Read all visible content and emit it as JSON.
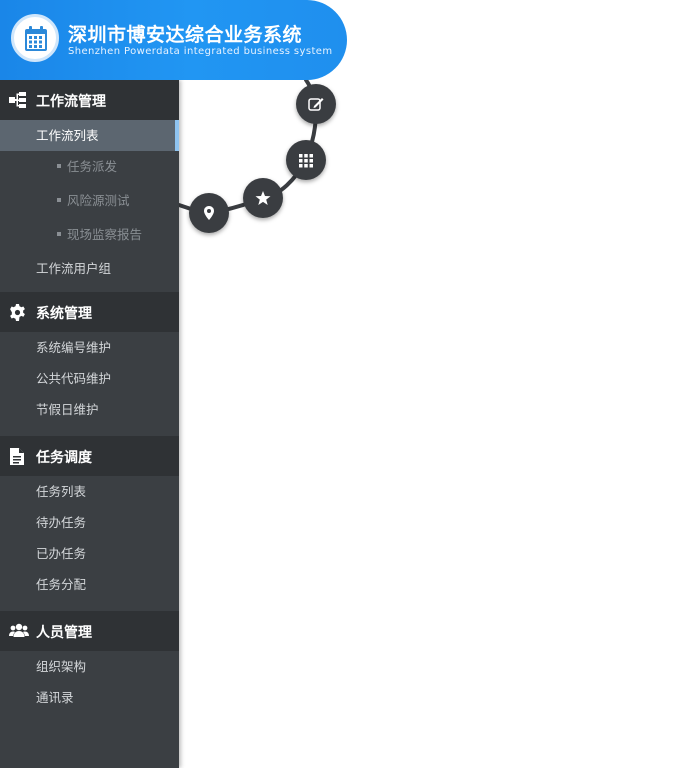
{
  "header": {
    "title_cn": "深圳市博安达综合业务系统",
    "title_en": "Shenzhen Powerdata integrated business system",
    "logo_icon": "calendar-icon"
  },
  "sidebar": {
    "groups": [
      {
        "title": "工作流管理",
        "icon": "sitemap-icon",
        "items": [
          {
            "label": "工作流列表",
            "active": true
          },
          {
            "label": "工作流用户组"
          }
        ],
        "subitems": [
          "任务派发",
          "风险源测试",
          "现场监察报告"
        ]
      },
      {
        "title": "系统管理",
        "icon": "gear-icon",
        "items": [
          {
            "label": "系统编号维护"
          },
          {
            "label": "公共代码维护"
          },
          {
            "label": "节假日维护"
          }
        ]
      },
      {
        "title": "任务调度",
        "icon": "document-icon",
        "items": [
          {
            "label": "任务列表"
          },
          {
            "label": "待办任务"
          },
          {
            "label": "已办任务"
          },
          {
            "label": "任务分配"
          }
        ]
      },
      {
        "title": "人员管理",
        "icon": "users-icon",
        "items": [
          {
            "label": "组织架构"
          },
          {
            "label": "通讯录"
          }
        ]
      }
    ]
  },
  "arc_menu": {
    "buttons": [
      "edit-icon",
      "grid-icon",
      "star-icon",
      "map-pin-icon"
    ]
  },
  "colors": {
    "header_blue": "#1f8fee",
    "sidebar_bg": "#3b3f43",
    "group_head_bg": "#2f3235",
    "active_item_bg": "#5c6670",
    "active_marker": "#8fc3ef"
  }
}
